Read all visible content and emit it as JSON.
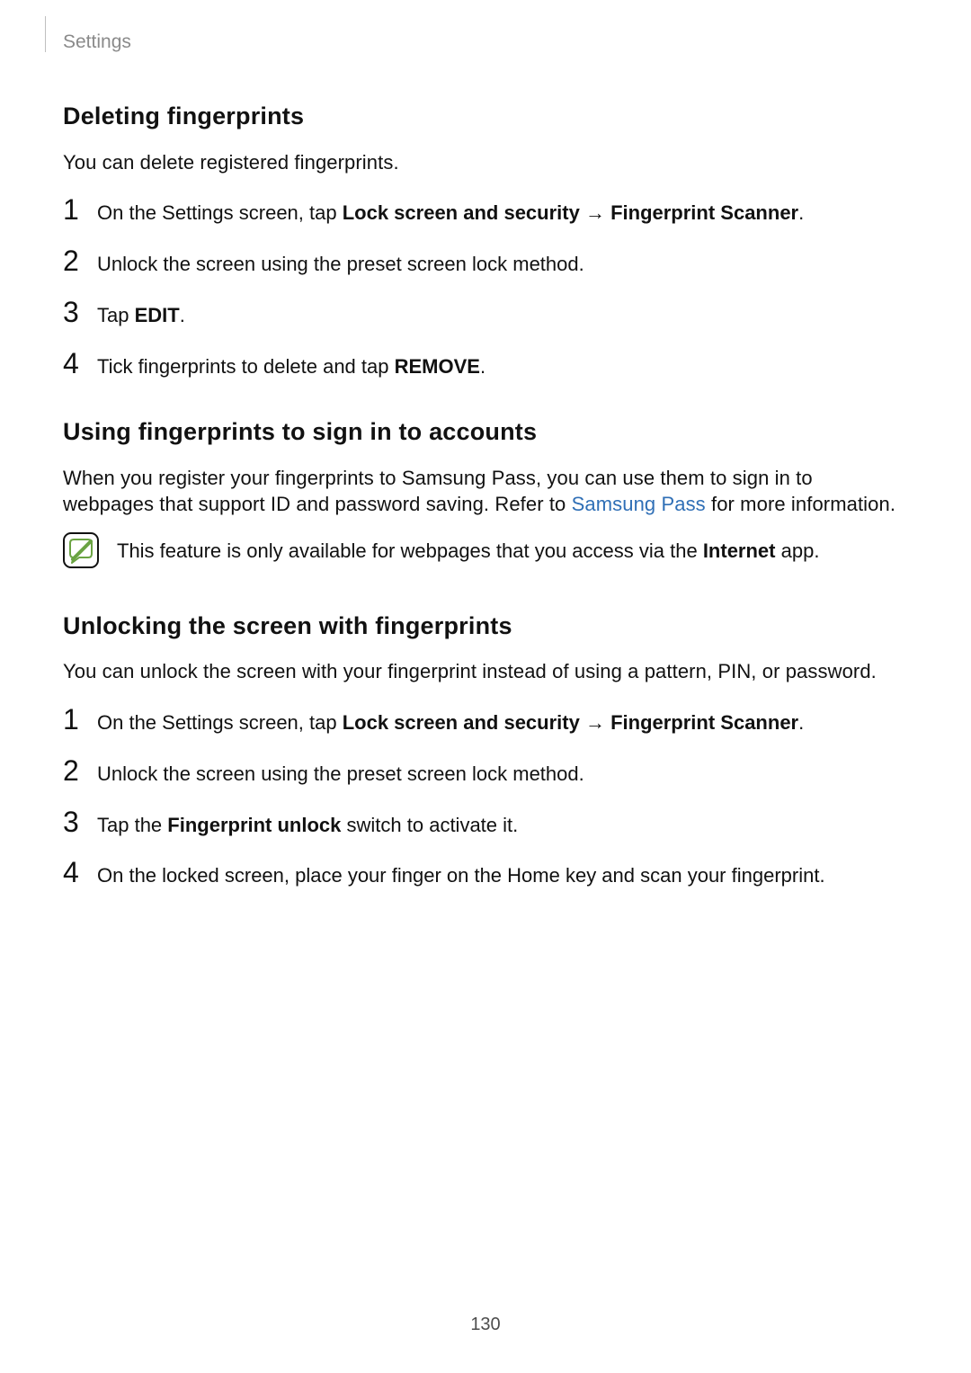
{
  "header": {
    "breadcrumb": "Settings"
  },
  "link_color": "#2f6fb6",
  "sections": {
    "deleting": {
      "title": "Deleting fingerprints",
      "intro": "You can delete registered fingerprints.",
      "steps": {
        "s1_pre": "On the Settings screen, tap ",
        "s1_b1": "Lock screen and security",
        "s1_arrow": " → ",
        "s1_b2": "Fingerprint Scanner",
        "s1_post": ".",
        "s2": "Unlock the screen using the preset screen lock method.",
        "s3_pre": "Tap ",
        "s3_b": "EDIT",
        "s3_post": ".",
        "s4_pre": "Tick fingerprints to delete and tap ",
        "s4_b": "REMOVE",
        "s4_post": "."
      }
    },
    "signin": {
      "title": "Using fingerprints to sign in to accounts",
      "p_pre": "When you register your fingerprints to Samsung Pass, you can use them to sign in to webpages that support ID and password saving. Refer to ",
      "p_link": "Samsung Pass",
      "p_post": " for more information.",
      "note_pre": "This feature is only available for webpages that you access via the ",
      "note_b": "Internet",
      "note_post": " app."
    },
    "unlock": {
      "title": "Unlocking the screen with fingerprints",
      "intro": "You can unlock the screen with your fingerprint instead of using a pattern, PIN, or password.",
      "steps": {
        "s1_pre": "On the Settings screen, tap ",
        "s1_b1": "Lock screen and security",
        "s1_arrow": " → ",
        "s1_b2": "Fingerprint Scanner",
        "s1_post": ".",
        "s2": "Unlock the screen using the preset screen lock method.",
        "s3_pre": "Tap the ",
        "s3_b": "Fingerprint unlock",
        "s3_post": " switch to activate it.",
        "s4": "On the locked screen, place your finger on the Home key and scan your fingerprint."
      }
    }
  },
  "numbers": {
    "n1": "1",
    "n2": "2",
    "n3": "3",
    "n4": "4"
  },
  "page_number": "130"
}
